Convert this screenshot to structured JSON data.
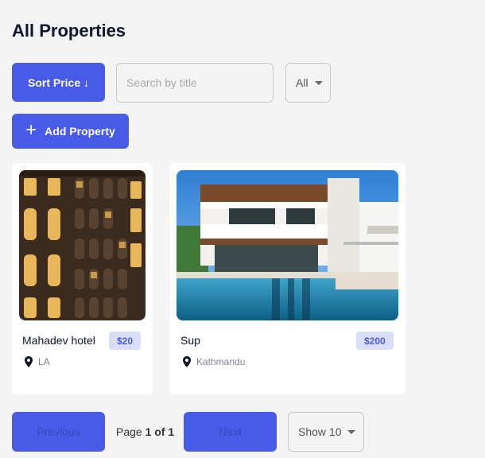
{
  "header": {
    "title": "All Properties"
  },
  "toolbar": {
    "sort_label": "Sort Price ↓",
    "search_placeholder": "Search by title",
    "type_filter_value": "All",
    "add_label": "Add Property"
  },
  "properties": [
    {
      "title": "Mahadev hotel",
      "price": "$20",
      "location": "LA"
    },
    {
      "title": "Sup",
      "price": "$200",
      "location": "Kathmandu"
    }
  ],
  "pagination": {
    "previous_label": "Previous",
    "page_prefix": "Page",
    "page_current": "1 of 1",
    "next_label": "Next",
    "page_size_value": "Show 10"
  },
  "colors": {
    "accent": "#475be8",
    "badge_bg": "#dadefa",
    "page_bg": "#f4f4f4"
  }
}
